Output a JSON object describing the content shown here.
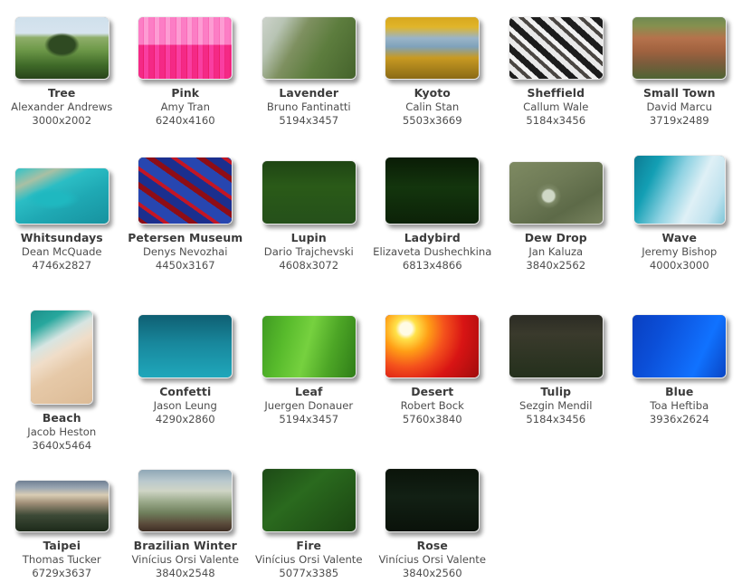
{
  "view": {
    "background_color": "#ffffff",
    "title_color": "#3b3b3b",
    "meta_color": "#4e4e4e",
    "columns": 6
  },
  "wallpapers": [
    {
      "title": "Tree",
      "author": "Alexander Andrews",
      "dimensions": "3000x2002",
      "art": "a-tree",
      "orientation": "landscape",
      "thumb_w": 103,
      "thumb_h": 68
    },
    {
      "title": "Pink",
      "author": "Amy Tran",
      "dimensions": "6240x4160",
      "art": "a-pink",
      "orientation": "landscape",
      "thumb_w": 103,
      "thumb_h": 68
    },
    {
      "title": "Lavender",
      "author": "Bruno Fantinatti",
      "dimensions": "5194x3457",
      "art": "a-lavender",
      "orientation": "landscape",
      "thumb_w": 103,
      "thumb_h": 68
    },
    {
      "title": "Kyoto",
      "author": "Calin Stan",
      "dimensions": "5503x3669",
      "art": "a-kyoto",
      "orientation": "landscape",
      "thumb_w": 103,
      "thumb_h": 68
    },
    {
      "title": "Sheffield",
      "author": "Callum Wale",
      "dimensions": "5184x3456",
      "art": "a-sheffield",
      "orientation": "landscape",
      "thumb_w": 103,
      "thumb_h": 68
    },
    {
      "title": "Small Town",
      "author": "David Marcu",
      "dimensions": "3719x2489",
      "art": "a-smalltown",
      "orientation": "landscape",
      "thumb_w": 103,
      "thumb_h": 68
    },
    {
      "title": "Whitsundays",
      "author": "Dean McQuade",
      "dimensions": "4746x2827",
      "art": "a-whitsundays",
      "orientation": "wide",
      "thumb_w": 103,
      "thumb_h": 61
    },
    {
      "title": "Petersen Museum",
      "author": "Denys Nevozhai",
      "dimensions": "4450x3167",
      "art": "a-petersen",
      "orientation": "landscape",
      "thumb_w": 103,
      "thumb_h": 73
    },
    {
      "title": "Lupin",
      "author": "Dario Trajchevski",
      "dimensions": "4608x3072",
      "art": "a-lupin",
      "orientation": "landscape",
      "thumb_w": 103,
      "thumb_h": 69
    },
    {
      "title": "Ladybird",
      "author": "Elizaveta Dushechkina",
      "dimensions": "6813x4866",
      "art": "a-ladybird",
      "orientation": "landscape",
      "thumb_w": 103,
      "thumb_h": 73
    },
    {
      "title": "Dew Drop",
      "author": "Jan Kaluza",
      "dimensions": "3840x2562",
      "art": "a-dewdrop",
      "orientation": "landscape",
      "thumb_w": 103,
      "thumb_h": 68
    },
    {
      "title": "Wave",
      "author": "Jeremy Bishop",
      "dimensions": "4000x3000",
      "art": "a-wave",
      "orientation": "landscape",
      "thumb_w": 100,
      "thumb_h": 75
    },
    {
      "title": "Beach",
      "author": "Jacob Heston",
      "dimensions": "3640x5464",
      "art": "a-beach",
      "orientation": "portrait",
      "thumb_w": 68,
      "thumb_h": 103
    },
    {
      "title": "Confetti",
      "author": "Jason Leung",
      "dimensions": "4290x2860",
      "art": "a-confetti",
      "orientation": "landscape",
      "thumb_w": 103,
      "thumb_h": 69
    },
    {
      "title": "Leaf",
      "author": "Juergen Donauer",
      "dimensions": "5194x3457",
      "art": "a-leaf",
      "orientation": "landscape",
      "thumb_w": 103,
      "thumb_h": 68
    },
    {
      "title": "Desert",
      "author": "Robert Bock",
      "dimensions": "5760x3840",
      "art": "a-desert",
      "orientation": "landscape",
      "thumb_w": 103,
      "thumb_h": 69
    },
    {
      "title": "Tulip",
      "author": "Sezgin Mendil",
      "dimensions": "5184x3456",
      "art": "a-tulip",
      "orientation": "landscape",
      "thumb_w": 103,
      "thumb_h": 69
    },
    {
      "title": "Blue",
      "author": "Toa Heftiba",
      "dimensions": "3936x2624",
      "art": "a-blue",
      "orientation": "landscape",
      "thumb_w": 103,
      "thumb_h": 69
    },
    {
      "title": "Taipei",
      "author": "Thomas Tucker",
      "dimensions": "6729x3637",
      "art": "a-taipei",
      "orientation": "wide",
      "thumb_w": 103,
      "thumb_h": 56
    },
    {
      "title": "Brazilian Winter",
      "author": "Vinícius Orsi Valente",
      "dimensions": "3840x2548",
      "art": "a-brazilian",
      "orientation": "landscape",
      "thumb_w": 103,
      "thumb_h": 68
    },
    {
      "title": "Fire",
      "author": "Vinícius Orsi Valente",
      "dimensions": "5077x3385",
      "art": "a-fire",
      "orientation": "landscape",
      "thumb_w": 103,
      "thumb_h": 69
    },
    {
      "title": "Rose",
      "author": "Vinícius Orsi Valente",
      "dimensions": "3840x2560",
      "art": "a-rose",
      "orientation": "landscape",
      "thumb_w": 103,
      "thumb_h": 69
    }
  ]
}
